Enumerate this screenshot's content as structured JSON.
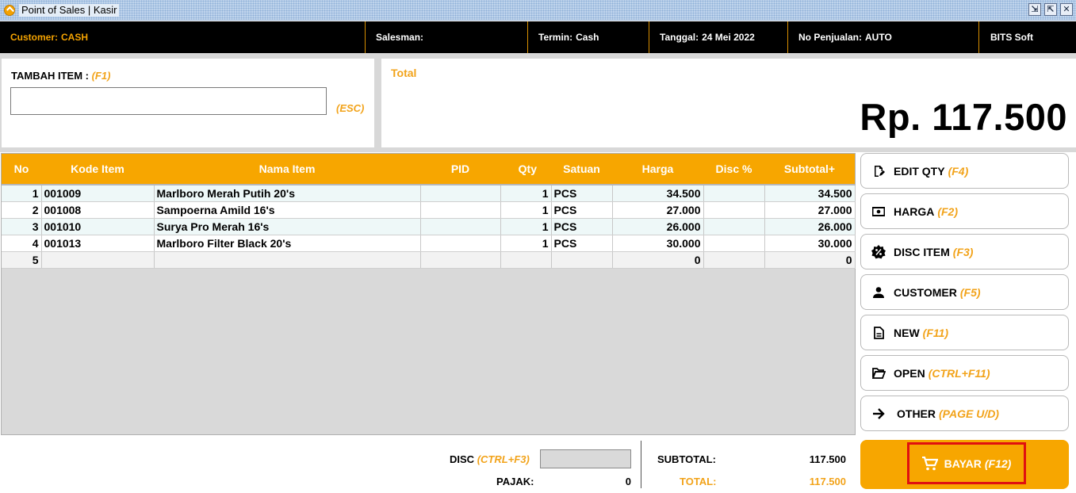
{
  "window": {
    "title": "Point of Sales | Kasir",
    "controls": [
      "restore-icon",
      "maximize-icon",
      "close-icon"
    ]
  },
  "infobar": {
    "customer_label": "Customer:",
    "customer_value": "CASH",
    "salesman_label": "Salesman:",
    "salesman_value": "",
    "termin_label": "Termin:",
    "termin_value": "Cash",
    "tanggal_label": "Tanggal:",
    "tanggal_value": "24 Mei 2022",
    "nopenjualan_label": "No Penjualan:",
    "nopenjualan_value": "AUTO",
    "brand": "BITS Soft"
  },
  "add_item": {
    "label": "TAMBAH ITEM :",
    "shortcut": "(F1)",
    "input_value": "",
    "esc_hint": "(ESC)"
  },
  "total_panel": {
    "label": "Total",
    "amount": "Rp. 117.500"
  },
  "table": {
    "columns": [
      "No",
      "Kode Item",
      "Nama Item",
      "PID",
      "Qty",
      "Satuan",
      "Harga",
      "Disc %",
      "Subtotal+"
    ],
    "rows": [
      {
        "no": "1",
        "kode": "001009",
        "nama": "Marlboro Merah Putih 20's",
        "pid": "",
        "qty": "1",
        "satuan": "PCS",
        "harga": "34.500",
        "disc": "",
        "subtotal": "34.500"
      },
      {
        "no": "2",
        "kode": "001008",
        "nama": "Sampoerna Amild 16's",
        "pid": "",
        "qty": "1",
        "satuan": "PCS",
        "harga": "27.000",
        "disc": "",
        "subtotal": "27.000"
      },
      {
        "no": "3",
        "kode": "001010",
        "nama": "Surya Pro Merah 16's",
        "pid": "",
        "qty": "1",
        "satuan": "PCS",
        "harga": "26.000",
        "disc": "",
        "subtotal": "26.000"
      },
      {
        "no": "4",
        "kode": "001013",
        "nama": "Marlboro Filter Black 20's",
        "pid": "",
        "qty": "1",
        "satuan": "PCS",
        "harga": "30.000",
        "disc": "",
        "subtotal": "30.000"
      },
      {
        "no": "5",
        "kode": "",
        "nama": "",
        "pid": "",
        "qty": "",
        "satuan": "",
        "harga": "0",
        "disc": "",
        "subtotal": "0"
      }
    ]
  },
  "actions": [
    {
      "label": "EDIT QTY",
      "shortcut": "(F4)",
      "icon": "edit-icon"
    },
    {
      "label": "HARGA",
      "shortcut": "(F2)",
      "icon": "money-icon"
    },
    {
      "label": "DISC ITEM",
      "shortcut": "(F3)",
      "icon": "discount-icon"
    },
    {
      "label": "CUSTOMER",
      "shortcut": "(F5)",
      "icon": "person-icon"
    },
    {
      "label": "NEW",
      "shortcut": "(F11)",
      "icon": "document-icon"
    },
    {
      "label": "OPEN",
      "shortcut": "(CTRL+F11)",
      "icon": "folder-open-icon"
    },
    {
      "label": "OTHER",
      "shortcut": "(PAGE U/D)",
      "icon": "arrow-right-icon"
    }
  ],
  "bayar": {
    "label": "BAYAR",
    "shortcut": "(F12)",
    "icon": "cart-icon"
  },
  "footer": {
    "disc_label": "DISC",
    "disc_shortcut": "(CTRL+F3)",
    "disc_value": "",
    "pajak_label": "PAJAK:",
    "pajak_value": "0",
    "subtotal_label": "SUBTOTAL:",
    "subtotal_value": "117.500",
    "total_label": "TOTAL:",
    "total_value": "117.500"
  },
  "colors": {
    "accent": "#f7a600",
    "hint": "#f2a31a",
    "infobar_bg": "#000000",
    "highlight_border": "#e01010"
  }
}
